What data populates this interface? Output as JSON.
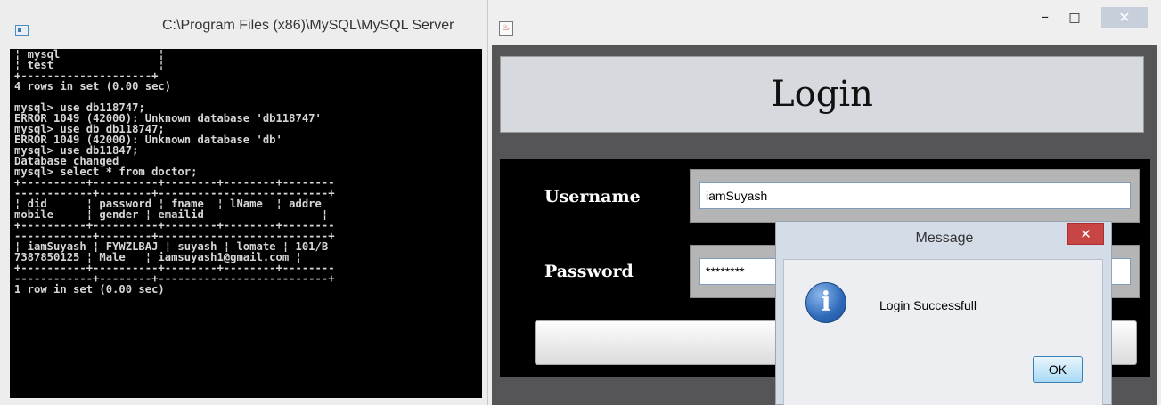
{
  "console": {
    "title": "C:\\Program Files (x86)\\MySQL\\MySQL Server",
    "lines": [
      "¦ mysql               ¦",
      "¦ test                ¦",
      "+--------------------+",
      "4 rows in set (0.00 sec)",
      "",
      "mysql> use db118747;",
      "ERROR 1049 (42000): Unknown database 'db118747'",
      "mysql> use db db118747;",
      "ERROR 1049 (42000): Unknown database 'db'",
      "mysql> use db11847;",
      "Database changed",
      "mysql> select * from doctor;",
      "+----------+----------+--------+--------+--------",
      "------------+--------+--------------------------+",
      "¦ did      ¦ password ¦ fname  ¦ lName  ¦ addre",
      "mobile     ¦ gender ¦ emailid                  ¦",
      "+----------+----------+--------+--------+--------",
      "------------+--------+--------------------------+",
      "¦ iamSuyash ¦ FYWZLBAJ ¦ suyash ¦ lomate ¦ 101/B",
      "7387850125 ¦ Male   ¦ iamsuyash1@gmail.com ¦",
      "+----------+----------+--------+--------+--------",
      "------------+--------+--------------------------+",
      "1 row in set (0.00 sec)"
    ]
  },
  "login_window": {
    "controls": {
      "minimize": "–",
      "maximize": "□",
      "close": "✕"
    },
    "header_title": "Login",
    "username_label": "Username",
    "username_value": "iamSuyash",
    "password_label": "Password",
    "password_value": "********"
  },
  "dialog": {
    "title": "Message",
    "close": "✕",
    "message": "Login Successfull",
    "ok_label": "OK",
    "icon": "info-icon"
  }
}
